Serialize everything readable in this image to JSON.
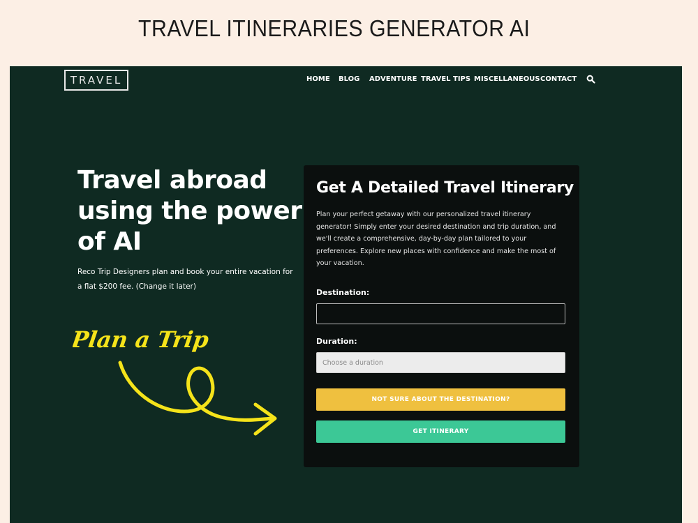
{
  "page_title": "TRAVEL ITINERARIES GENERATOR AI",
  "header": {
    "logo_text": "TRAVEL",
    "nav": [
      "HOME",
      "BLOG",
      "ADVENTURE",
      "TRAVEL TIPS",
      "MISCELLANEOUS",
      "CONTACT"
    ],
    "search_icon": "search-icon"
  },
  "hero": {
    "heading_lines": [
      "Travel abroad",
      "using the power",
      "of AI"
    ],
    "subtext": "Reco Trip Designers plan and book your entire vacation for a flat $200 fee. (Change it later)",
    "script_text": "Plan a Trip"
  },
  "card": {
    "title": "Get A Detailed Travel Itinerary",
    "description": "Plan your perfect getaway with our personalized travel itinerary generator! Simply enter your desired destination and trip duration, and we'll create a comprehensive, day-by-day plan tailored to your preferences. Explore new places with confidence and make the most of your vacation.",
    "destination_label": "Destination:",
    "destination_value": "",
    "duration_label": "Duration:",
    "duration_placeholder": "Choose a duration",
    "unsure_button": "NOT SURE ABOUT THE DESTINATION?",
    "submit_button": "GET ITINERARY"
  },
  "colors": {
    "page_bg": "#fcefe5",
    "site_bg": "#0f2a22",
    "card_bg": "#0b0f0e",
    "accent_yellow": "#efc03f",
    "accent_green": "#3cc896",
    "script_yellow": "#f5e31a"
  }
}
